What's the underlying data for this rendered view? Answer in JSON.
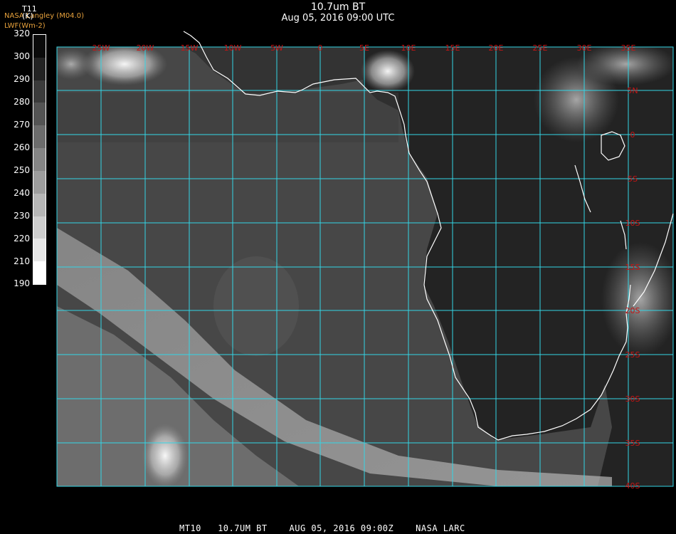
{
  "title": "10.7um BT",
  "subtitle": "Aug 05, 2016 09:00 UTC",
  "source_line1": "NASA Langley (M04.0)",
  "source_line2": "LWF(Wm-2)",
  "variable_label": "T11",
  "variable_unit": "(K)",
  "colorbar": {
    "ticks": [
      "320",
      "300",
      "290",
      "280",
      "270",
      "260",
      "250",
      "240",
      "230",
      "220",
      "210",
      "190"
    ]
  },
  "longitude_labels": [
    "25W",
    "20W",
    "15W",
    "10W",
    "5W",
    "0",
    "5E",
    "10E",
    "15E",
    "20E",
    "25E",
    "30E",
    "35E"
  ],
  "latitude_labels": [
    "5N",
    "0",
    "5S",
    "10S",
    "15S",
    "20S",
    "25S",
    "30S",
    "35S",
    "40S"
  ],
  "footer": "MT10   10.7UM BT    AUG 05, 2016 09:00Z    NASA LARC",
  "colors": {
    "grid": "#33d6e6",
    "coastline": "#ffffff",
    "grid_label": "#c81414",
    "source_text": "#e8a23c"
  }
}
